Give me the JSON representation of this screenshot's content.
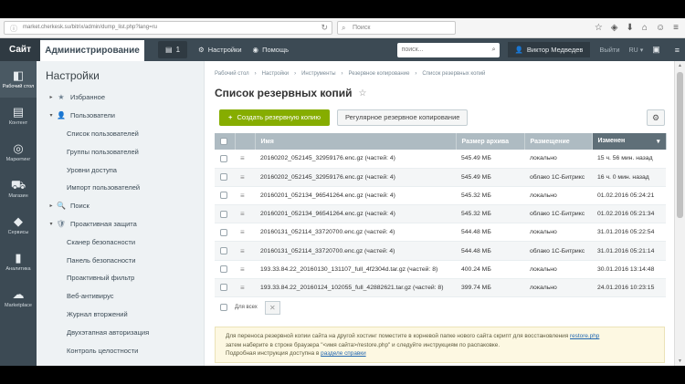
{
  "browser": {
    "url": "market.cherkesk.su/bitrix/admin/dump_list.php?lang=ru",
    "search_placeholder": "Поиск"
  },
  "panel": {
    "site_label": "Сайт",
    "admin_label": "Администрирование",
    "notifications_count": "1",
    "settings_label": "Настройки",
    "help_label": "Помощь",
    "search_placeholder": "поиск...",
    "user_name": "Виктор Медведев",
    "logout_label": "Выйти",
    "lang_label": "RU"
  },
  "rail": [
    {
      "label": "Рабочий стол",
      "icon": "desktop-icon"
    },
    {
      "label": "Контент",
      "icon": "document-icon"
    },
    {
      "label": "Маркетинг",
      "icon": "target-icon"
    },
    {
      "label": "Магазин",
      "icon": "cart-icon"
    },
    {
      "label": "Сервисы",
      "icon": "layers-icon"
    },
    {
      "label": "Аналитика",
      "icon": "bar-chart-icon"
    },
    {
      "label": "Marketplace",
      "icon": "cloud-icon"
    }
  ],
  "menu": {
    "title": "Настройки",
    "items": [
      {
        "label": "Избранное",
        "level": 0,
        "arrow": "▸",
        "icon": "★"
      },
      {
        "label": "Пользователи",
        "level": 0,
        "arrow": "▾",
        "icon": "👤"
      },
      {
        "label": "Список пользователей",
        "level": 1
      },
      {
        "label": "Группы пользователей",
        "level": 1
      },
      {
        "label": "Уровни доступа",
        "level": 1
      },
      {
        "label": "Импорт пользователей",
        "level": 1
      },
      {
        "label": "Поиск",
        "level": 0,
        "arrow": "▸",
        "icon": "🔍"
      },
      {
        "label": "Проактивная защита",
        "level": 0,
        "arrow": "▾",
        "icon": "🛡"
      },
      {
        "label": "Сканер безопасности",
        "level": 1
      },
      {
        "label": "Панель безопасности",
        "level": 1
      },
      {
        "label": "Проактивный фильтр",
        "level": 1
      },
      {
        "label": "Веб-антивирус",
        "level": 1
      },
      {
        "label": "Журнал вторжений",
        "level": 1
      },
      {
        "label": "Двухэтапная авторизация",
        "level": 1
      },
      {
        "label": "Контроль целостности",
        "level": 1
      }
    ]
  },
  "breadcrumbs": [
    "Рабочий стол",
    "Настройки",
    "Инструменты",
    "Резервное копирование",
    "Список резервных копий"
  ],
  "page_title": "Список резервных копий",
  "toolbar": {
    "create_label": "Создать резервную копию",
    "schedule_label": "Регулярное резервное копирование"
  },
  "table": {
    "columns": [
      "Имя",
      "Размер архива",
      "Размещение",
      "Изменен"
    ],
    "rows": [
      {
        "name": "20160202_052145_32959176.enc.gz (частей: 4)",
        "size": "545.49 МБ",
        "place": "локально",
        "changed": "15 ч. 56 мин. назад"
      },
      {
        "name": "20160202_052145_32959176.enc.gz (частей: 4)",
        "size": "545.49 МБ",
        "place": "облако 1С-Битрикс",
        "changed": "16 ч. 0 мин. назад"
      },
      {
        "name": "20160201_052134_96541264.enc.gz (частей: 4)",
        "size": "545.32 МБ",
        "place": "локально",
        "changed": "01.02.2016 05:24:21"
      },
      {
        "name": "20160201_052134_96541264.enc.gz (частей: 4)",
        "size": "545.32 МБ",
        "place": "облако 1С-Битрикс",
        "changed": "01.02.2016 05:21:34"
      },
      {
        "name": "20160131_052114_33720700.enc.gz (частей: 4)",
        "size": "544.48 МБ",
        "place": "локально",
        "changed": "31.01.2016 05:22:54"
      },
      {
        "name": "20160131_052114_33720700.enc.gz (частей: 4)",
        "size": "544.48 МБ",
        "place": "облако 1С-Битрикс",
        "changed": "31.01.2016 05:21:14"
      },
      {
        "name": "193.33.84.22_20160130_131107_full_4f2304d.tar.gz (частей: 8)",
        "size": "400.24 МБ",
        "place": "локально",
        "changed": "30.01.2016 13:14:48"
      },
      {
        "name": "193.33.84.22_20160124_102055_full_42882621.tar.gz (частей: 8)",
        "size": "399.74 МБ",
        "place": "локально",
        "changed": "24.01.2016 10:23:15"
      }
    ],
    "select_all_label": "Для всех"
  },
  "note": {
    "line1": "Для переноса резервной копии сайта на другой хостинг поместите в корневой папке нового сайта скрипт для восстановления",
    "restore_link": "restore.php",
    "line2": "затем наберите в строке браузера \"<имя сайта>/restore.php\" и следуйте инструкциям по распаковке.",
    "line3": "Подробная инструкция доступна в",
    "help_link": "разделе справки"
  }
}
